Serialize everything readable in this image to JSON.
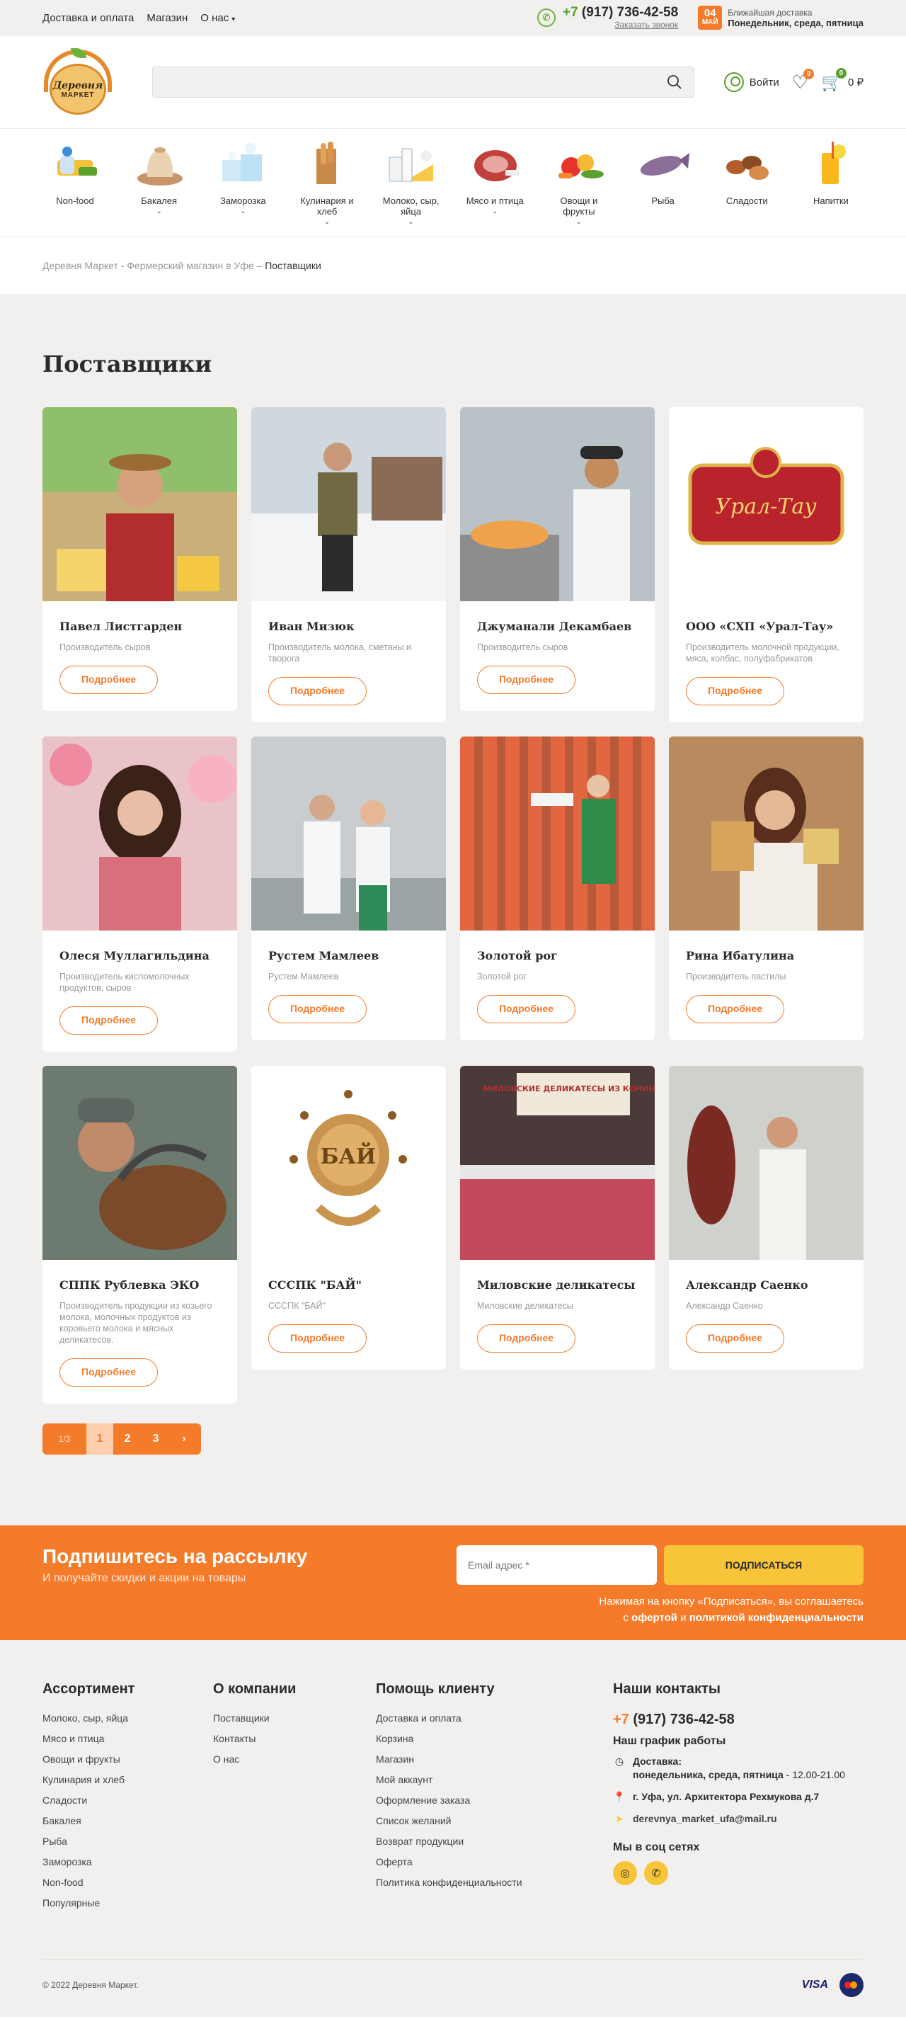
{
  "topbar": {
    "links": [
      "Доставка и оплата",
      "Магазин",
      "О нас"
    ],
    "phone_prefix": "+7",
    "phone_rest": " (917) 736-42-58",
    "callback": "Заказать звонок",
    "cal_day": "04",
    "cal_month": "МАЙ",
    "delivery_title": "Ближайшая доставка",
    "delivery_days": "Понедельник, среда, пятница"
  },
  "header": {
    "logo_line1": "Деревня",
    "logo_line2": "МАРКЕТ",
    "search_placeholder": "",
    "login": "Войти",
    "wishlist_count": "0",
    "cart_count": "0",
    "cart_total": "0 ₽"
  },
  "categories": [
    {
      "label": "Non-food",
      "has_sub": false
    },
    {
      "label": "Бакалея",
      "has_sub": true
    },
    {
      "label": "Заморозка",
      "has_sub": true
    },
    {
      "label": "Кулинария и хлеб",
      "has_sub": true
    },
    {
      "label": "Молоко, сыр, яйца",
      "has_sub": true
    },
    {
      "label": "Мясо и птица",
      "has_sub": true
    },
    {
      "label": "Овощи и фрукты",
      "has_sub": true
    },
    {
      "label": "Рыба",
      "has_sub": false
    },
    {
      "label": "Сладости",
      "has_sub": false
    },
    {
      "label": "Напитки",
      "has_sub": false
    }
  ],
  "breadcrumb": {
    "home": "Деревня Маркет - Фермерский магазин в Уфе",
    "sep": " – ",
    "current": "Поставщики"
  },
  "page_title": "Поставщики",
  "suppliers": [
    {
      "name": "Павел Листгарден",
      "desc": "Производитель сыров"
    },
    {
      "name": "Иван Мизюк",
      "desc": "Производитель молока, сметаны и творога"
    },
    {
      "name": "Джуманали Декамбаев",
      "desc": "Производитель сыров"
    },
    {
      "name": "ООО «СХП «Урал-Тау»",
      "desc": "Производитель молочной продукции, мяса, колбас, полуфабрикатов"
    },
    {
      "name": "Олеся Муллагильдина",
      "desc": "Производитель кисломолочных продуктов, сыров"
    },
    {
      "name": "Рустем Мамлеев",
      "desc": "Рустем Мамлеев"
    },
    {
      "name": "Золотой рог",
      "desc": "Золотой рог"
    },
    {
      "name": "Рина Ибатулина",
      "desc": "Производитель пастилы"
    },
    {
      "name": "СППК Рублевка ЭКО",
      "desc": "Производитель продукции из козьего молока, молочных продуктов из коровьего молока и мясных деликатесов."
    },
    {
      "name": "СССПК \"БАЙ\"",
      "desc": "СССПК \"БАЙ\""
    },
    {
      "name": "Миловские деликатесы",
      "desc": "Миловские деликатесы"
    },
    {
      "name": "Александр Саенко",
      "desc": "Александр Саенко"
    }
  ],
  "more_label": "Подробнее",
  "logo_texts": {
    "ural": "Урал-Тау",
    "bai": "БАЙ",
    "shop_sign": "МИЛОВСКИЕ ДЕЛИКАТЕСЫ ИЗ КОНИНЫ"
  },
  "pager": {
    "info": "1/3",
    "pages": [
      "1",
      "2",
      "3"
    ],
    "next": "›"
  },
  "subscribe": {
    "title": "Подпишитесь на рассылку",
    "subtitle": "И получайте скидки и акции на товары",
    "email_placeholder": "Email адрес *",
    "button": "ПОДПИСАТЬСЯ",
    "note1": "Нажимая на кнопку «Подписаться», вы соглашаетесь",
    "note2_pre": "с ",
    "note2_offer": "офертой",
    "note2_and": " и ",
    "note2_policy": "политикой конфиденциальности"
  },
  "footer": {
    "assortment_title": "Ассортимент",
    "assortment": [
      "Молоко, сыр, яйца",
      "Мясо и птица",
      "Овощи и фрукты",
      "Кулинария и хлеб",
      "Сладости",
      "Бакалея",
      "Рыба",
      "Заморозка",
      "Non-food",
      "Популярные"
    ],
    "company_title": "О компании",
    "company": [
      "Поставщики",
      "Контакты",
      "О нас"
    ],
    "help_title": "Помощь клиенту",
    "help": [
      "Доставка и оплата",
      "Корзина",
      "Магазин",
      "Мой аккаунт",
      "Оформление заказа",
      "Список желаний",
      "Возврат продукции",
      "Оферта",
      "Политика конфиденциальности"
    ],
    "contacts_title": "Наши контакты",
    "phone_prefix": "+7",
    "phone_rest": " (917) 736-42-58",
    "schedule_title": "Наш график работы",
    "delivery_label": "Доставка:",
    "delivery_days": "понедельника, среда, пятница",
    "delivery_hours": " - 12.00-21.00",
    "address": "г. Уфа, ул. Архитектора Рехмукова д.7",
    "email": "derevnya_market_ufa@mail.ru",
    "social_title": "Мы в соц сетях",
    "copyright": "© 2022 Деревня Маркет.",
    "visa": "VISA"
  }
}
